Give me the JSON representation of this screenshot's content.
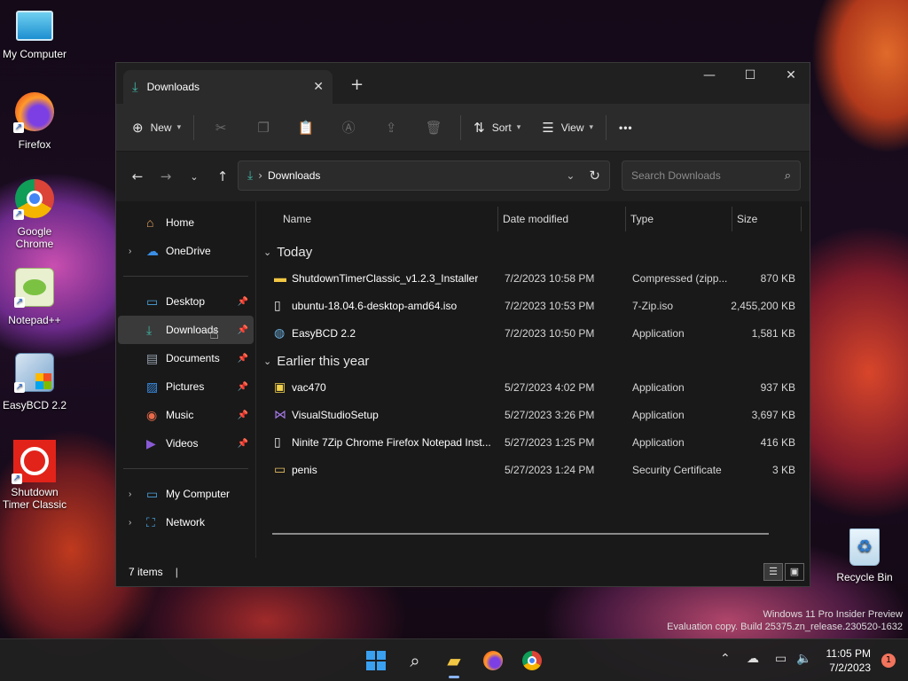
{
  "desktop": {
    "icons": [
      {
        "label": "My Computer"
      },
      {
        "label": "Firefox"
      },
      {
        "label": "Google Chrome"
      },
      {
        "label": "Notepad++"
      },
      {
        "label": "EasyBCD 2.2"
      },
      {
        "label": "Shutdown Timer Classic"
      },
      {
        "label": "Recycle Bin"
      }
    ]
  },
  "window": {
    "tab_title": "Downloads",
    "toolbar": {
      "new_label": "New",
      "sort_label": "Sort",
      "view_label": "View",
      "more_label": "•••"
    },
    "address": {
      "path": "Downloads",
      "search_placeholder": "Search Downloads"
    },
    "nav": {
      "home": "Home",
      "onedrive": "OneDrive",
      "desktop": "Desktop",
      "downloads": "Downloads",
      "documents": "Documents",
      "pictures": "Pictures",
      "music": "Music",
      "videos": "Videos",
      "my_computer": "My Computer",
      "network": "Network"
    },
    "columns": {
      "name": "Name",
      "date": "Date modified",
      "type": "Type",
      "size": "Size"
    },
    "groups": [
      {
        "label": "Today",
        "files": [
          {
            "name": "ShutdownTimerClassic_v1.2.3_Installer",
            "date": "7/2/2023 10:58 PM",
            "type": "Compressed (zipp...",
            "size": "870 KB",
            "icon": "zip-folder-icon"
          },
          {
            "name": "ubuntu-18.04.6-desktop-amd64.iso",
            "date": "7/2/2023 10:53 PM",
            "type": "7-Zip.iso",
            "size": "2,455,200 KB",
            "icon": "iso-file-icon"
          },
          {
            "name": "EasyBCD 2.2",
            "date": "7/2/2023 10:50 PM",
            "type": "Application",
            "size": "1,581 KB",
            "icon": "easybcd-icon"
          }
        ]
      },
      {
        "label": "Earlier this year",
        "files": [
          {
            "name": "vac470",
            "date": "5/27/2023 4:02 PM",
            "type": "Application",
            "size": "937 KB",
            "icon": "installer-icon"
          },
          {
            "name": "VisualStudioSetup",
            "date": "5/27/2023 3:26 PM",
            "type": "Application",
            "size": "3,697 KB",
            "icon": "visual-studio-icon"
          },
          {
            "name": "Ninite 7Zip Chrome Firefox Notepad Inst...",
            "date": "5/27/2023 1:25 PM",
            "type": "Application",
            "size": "416 KB",
            "icon": "file-icon"
          },
          {
            "name": "penis",
            "date": "5/27/2023 1:24 PM",
            "type": "Security Certificate",
            "size": "3 KB",
            "icon": "certificate-icon"
          }
        ]
      }
    ],
    "status": {
      "item_count": "7 items"
    }
  },
  "watermark": {
    "line1": "Windows 11 Pro Insider Preview",
    "line2": "Evaluation copy. Build 25375.zn_release.230520-1632"
  },
  "taskbar": {
    "time": "11:05 PM",
    "date": "7/2/2023",
    "notification_count": "1"
  }
}
